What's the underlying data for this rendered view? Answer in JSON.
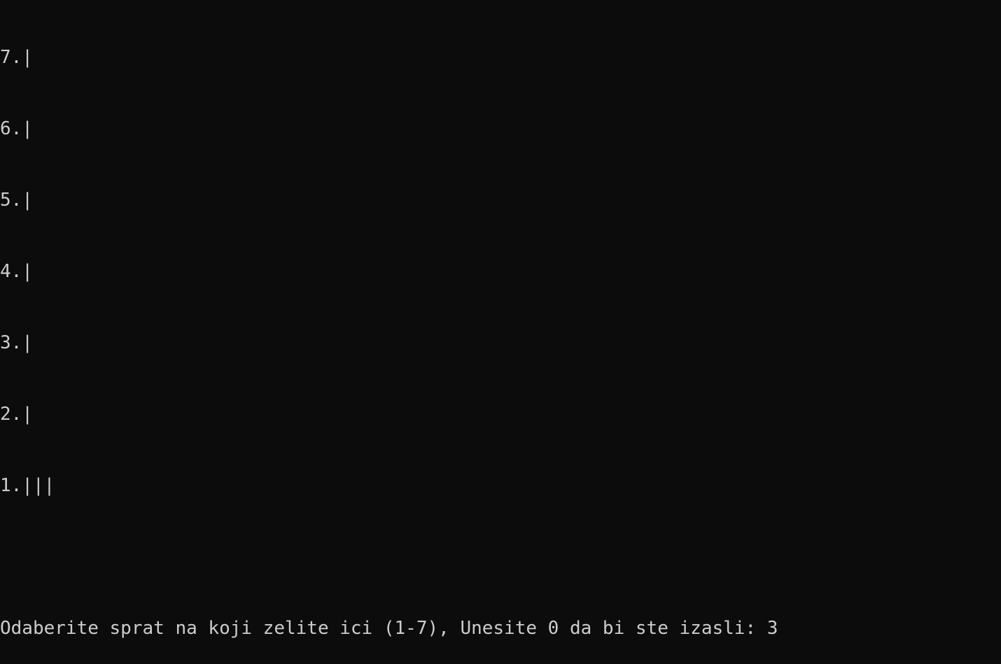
{
  "terminal": {
    "lines": [
      "7.|",
      "6.|",
      "5.|",
      "4.|",
      "3.|",
      "2.|",
      "1.|||",
      "",
      "Odaberite sprat na koji zelite ici (1-7), Unesite 0 da bi ste izasli: 3"
    ]
  },
  "colors": {
    "background": "#0c0c0c",
    "text": "#cccccc"
  }
}
